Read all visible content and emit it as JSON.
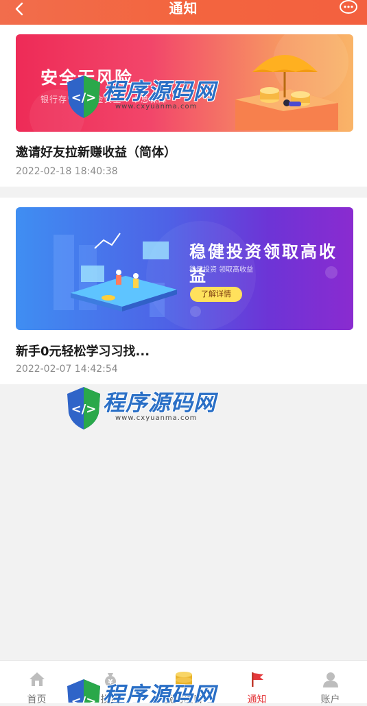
{
  "header": {
    "title": "通知",
    "back_icon": "chevron-left-icon",
    "message_icon": "chat-bubble-icon"
  },
  "notices": [
    {
      "banner": {
        "headline": "安全无风险",
        "subtext": "银行存管 · 资金安全 · 本息保障"
      },
      "title": "邀请好友拉新赚收益（简体）",
      "date": "2022-02-18 18:40:38"
    },
    {
      "banner": {
        "headline": "稳健投资领取高收益",
        "subtext": "稳健投资 领取高收益",
        "button": "了解详情"
      },
      "title": "新手0元轻松学习习找...",
      "date": "2022-02-07 14:42:54"
    }
  ],
  "watermark": {
    "text": "程序源码网",
    "url": "www.cxyuanma.com"
  },
  "tabbar": {
    "items": [
      {
        "label": "首页",
        "icon": "home-icon",
        "active": false
      },
      {
        "label": "投资",
        "icon": "money-bag-icon",
        "active": false
      },
      {
        "label": "我的项目",
        "icon": "coins-icon",
        "active": false
      },
      {
        "label": "通知",
        "icon": "flag-icon",
        "active": true
      },
      {
        "label": "账户",
        "icon": "user-icon",
        "active": false
      }
    ]
  },
  "colors": {
    "header": "#f3653f",
    "active_tab": "#e4393c",
    "background": "#f2f2f2"
  }
}
